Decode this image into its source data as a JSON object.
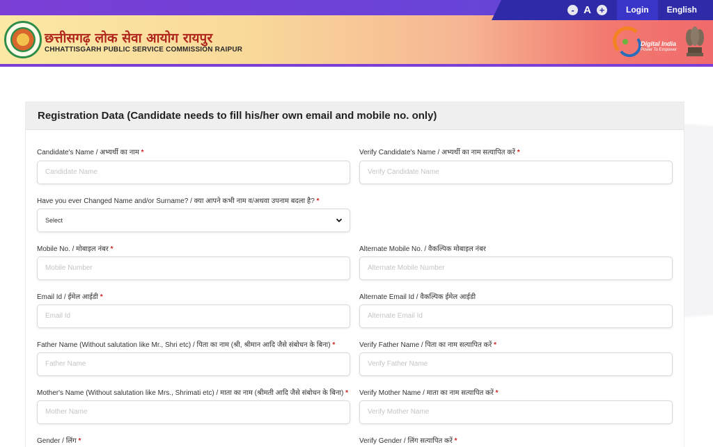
{
  "topbar": {
    "font_decrease": "-",
    "font_label": "A",
    "font_increase": "+",
    "login": "Login",
    "language": "English"
  },
  "header": {
    "title_hindi": "छत्तीसगढ़ लोक सेवा आयोग रायपुर",
    "title_english": "CHHATTISGARH PUBLIC SERVICE COMMISSION RAIPUR",
    "digital_india": "Digital India",
    "digital_india_tagline": "Power To Empower"
  },
  "form": {
    "heading": "Registration Data (Candidate needs to fill his/her own email and mobile no. only)",
    "required_mark": "*",
    "fields": [
      {
        "label": "Candidate's Name / अभ्यर्थी का नाम",
        "placeholder": "Candidate Name",
        "required": true
      },
      {
        "label": "Verify Candidate's Name / अभ्यर्थी का नाम सत्यापित करें",
        "placeholder": "Verify Candidate Name",
        "required": true
      },
      {
        "label": "Have you ever Changed Name and/or Surname? / क्या आपने कभी नाम व/अथवा उपनाम बदला है?",
        "value": "Select",
        "required": true
      },
      {
        "label": "Mobile No. / मोबाइल नंबर",
        "placeholder": "Mobile Number",
        "required": true
      },
      {
        "label": "Alternate Mobile No. / वैकल्पिक मोबाइल नंबर",
        "placeholder": "Alternate Mobile Number",
        "required": false
      },
      {
        "label": "Email Id / ईमेल आईडी",
        "placeholder": "Email Id",
        "required": true
      },
      {
        "label": "Alternate Email Id / वैकल्पिक ईमेल आईडी",
        "placeholder": "Alternate Email Id",
        "required": false
      },
      {
        "label": "Father Name (Without salutation like Mr., Shri etc) / पिता का नाम (श्री, श्रीमान आदि जैसे संबोधन के बिना)",
        "placeholder": "Father Name",
        "required": true
      },
      {
        "label": "Verify Father Name / पिता का नाम सत्यापित करें",
        "placeholder": "Verify Father Name",
        "required": true
      },
      {
        "label": "Mother's Name (Without salutation like Mrs., Shrimati etc) / माता का नाम (श्रीमती आदि जैसे संबोधन के बिना)",
        "placeholder": "Mother Name",
        "required": true
      },
      {
        "label": "Verify Mother Name / माता का नाम सत्यापित करें",
        "placeholder": "Verify Mother Name",
        "required": true
      },
      {
        "label": "Gender / लिंग",
        "required": true
      },
      {
        "label": "Verify Gender / लिंग सत्यापित करें",
        "required": true
      }
    ]
  },
  "colors": {
    "accent_purple": "#7b3fd6",
    "topbar_right": "#2f2aa7",
    "required_red": "#d32020",
    "title_red": "#b0261d"
  },
  "icons": {
    "select_chevron": "chevron-down-icon"
  }
}
